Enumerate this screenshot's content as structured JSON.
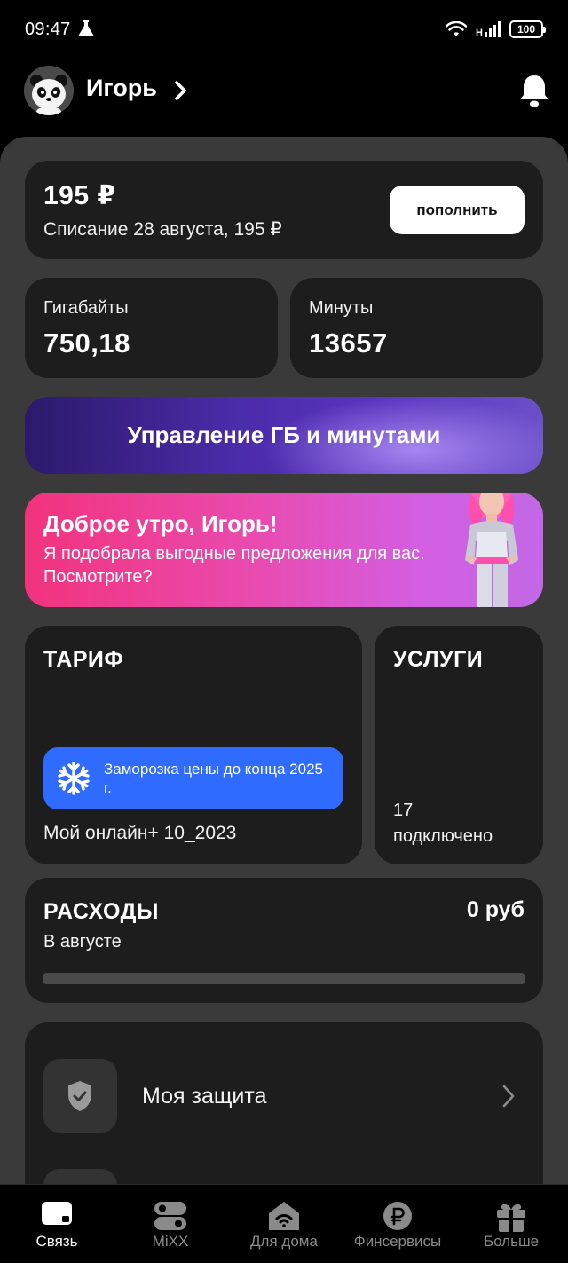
{
  "status_bar": {
    "time": "09:47",
    "network": "H",
    "battery": "100"
  },
  "header": {
    "user_name": "Игорь"
  },
  "balance": {
    "amount": "195 ₽",
    "note": "Списание 28 августа, 195 ₽",
    "topup_label": "пополнить"
  },
  "stats": [
    {
      "label": "Гигабайты",
      "value": "750,18"
    },
    {
      "label": "Минуты",
      "value": "13657"
    }
  ],
  "manage_banner": {
    "label": "Управление ГБ и минутами"
  },
  "promo": {
    "title": "Доброе утро, Игорь!",
    "text": "Я подобрала выгодные предложения для вас. Посмотрите?"
  },
  "tariff": {
    "title": "ТАРИФ",
    "badge": "Заморозка цены до конца 2025 г.",
    "name": "Мой онлайн+ 10_2023"
  },
  "services": {
    "title": "УСЛУГИ",
    "count_line1": "17",
    "count_line2": "подключено"
  },
  "expenses": {
    "title": "РАСХОДЫ",
    "amount": "0 руб",
    "period": "В августе",
    "spent_fraction": 0
  },
  "menu": {
    "items": [
      {
        "label": "Моя защита",
        "icon": "shield-check-icon"
      }
    ]
  },
  "tabbar": {
    "tabs": [
      {
        "label": "Связь",
        "icon": "sim-card-icon",
        "active": true
      },
      {
        "label": "MiXX",
        "icon": "mixx-icon",
        "active": false
      },
      {
        "label": "Для дома",
        "icon": "home-wifi-icon",
        "active": false
      },
      {
        "label": "Финсервисы",
        "icon": "ruble-icon",
        "active": false
      },
      {
        "label": "Больше",
        "icon": "gift-icon",
        "active": false
      }
    ]
  },
  "colors": {
    "accent_blue": "#2f6bff",
    "card": "#1d1d1d",
    "sheet": "#3a3a3a",
    "promo_pink": "#f2337d",
    "manage_purple": "#4a2ba8"
  }
}
